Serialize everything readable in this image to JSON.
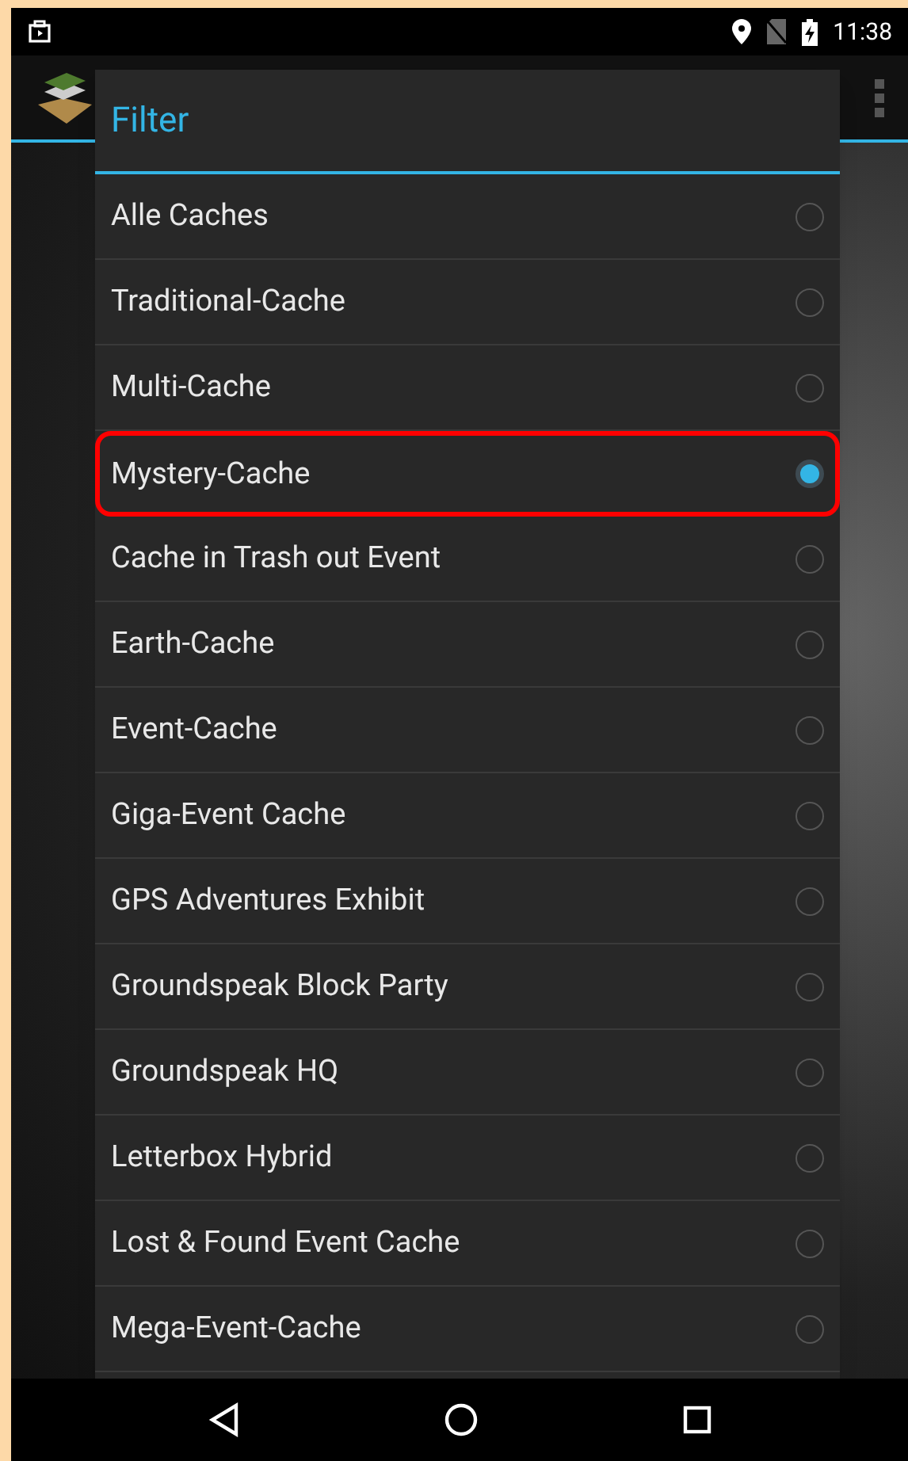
{
  "status_bar": {
    "time": "11:38"
  },
  "dialog": {
    "title": "Filter",
    "options": [
      {
        "label": "Alle Caches",
        "selected": false
      },
      {
        "label": "Traditional-Cache",
        "selected": false
      },
      {
        "label": "Multi-Cache",
        "selected": false
      },
      {
        "label": "Mystery-Cache",
        "selected": true
      },
      {
        "label": "Cache in Trash out Event",
        "selected": false
      },
      {
        "label": "Earth-Cache",
        "selected": false
      },
      {
        "label": "Event-Cache",
        "selected": false
      },
      {
        "label": "Giga-Event Cache",
        "selected": false
      },
      {
        "label": "GPS Adventures Exhibit",
        "selected": false
      },
      {
        "label": "Groundspeak Block Party",
        "selected": false
      },
      {
        "label": "Groundspeak HQ",
        "selected": false
      },
      {
        "label": "Letterbox Hybrid",
        "selected": false
      },
      {
        "label": "Lost & Found Event Cache",
        "selected": false
      },
      {
        "label": "Mega-Event-Cache",
        "selected": false
      }
    ]
  }
}
